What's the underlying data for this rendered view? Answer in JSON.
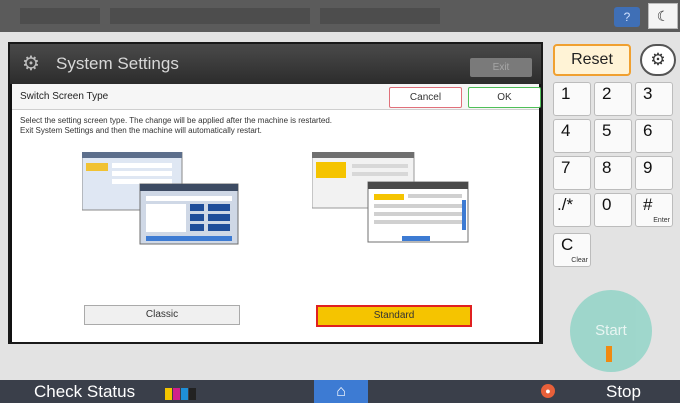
{
  "topbar": {
    "help_icon": "question-icon",
    "theme_icon": "moon-icon",
    "help_label": "?",
    "theme_label": "☾"
  },
  "dialog": {
    "title": "System Settings",
    "exit_label": "Exit",
    "subtitle": "Switch Screen Type",
    "cancel_label": "Cancel",
    "ok_label": "OK",
    "description_line1": "Select the setting screen type. The change will be applied after the machine is restarted.",
    "description_line2": "Exit System Settings and then the machine will automatically restart.",
    "options": [
      {
        "label": "Classic",
        "selected": false
      },
      {
        "label": "Standard",
        "selected": true
      }
    ]
  },
  "keypad": {
    "reset_label": "Reset",
    "keys": [
      {
        "main": "1",
        "sub": ""
      },
      {
        "main": "2",
        "sub": ""
      },
      {
        "main": "3",
        "sub": ""
      },
      {
        "main": "4",
        "sub": ""
      },
      {
        "main": "5",
        "sub": ""
      },
      {
        "main": "6",
        "sub": ""
      },
      {
        "main": "7",
        "sub": ""
      },
      {
        "main": "8",
        "sub": ""
      },
      {
        "main": "9",
        "sub": ""
      },
      {
        "main": "./*",
        "sub": ""
      },
      {
        "main": "0",
        "sub": ""
      },
      {
        "main": "#",
        "sub": "Enter"
      },
      {
        "main": "C",
        "sub": "Clear"
      }
    ],
    "start_label": "Start"
  },
  "bottombar": {
    "check_status_label": "Check Status",
    "toner_colors": [
      "#f2c400",
      "#d0208a",
      "#1e8fd8",
      "#222222"
    ],
    "stop_label": "Stop"
  },
  "colors": {
    "accent": "#3d7bd3",
    "selected": "#f5c400",
    "selected_border": "#e02020"
  }
}
